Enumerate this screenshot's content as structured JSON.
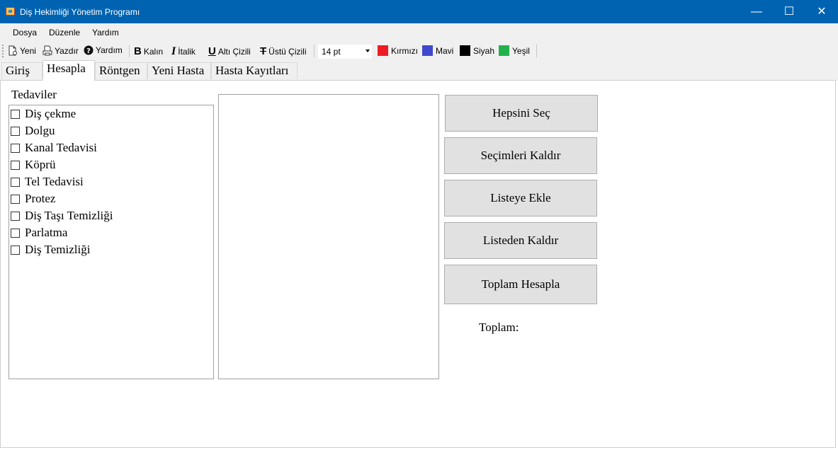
{
  "window": {
    "title": "Diş Hekimliği Yönetim Programı",
    "minimize": "—",
    "maximize": "☐",
    "close": "✕"
  },
  "menu": [
    "Dosya",
    "Düzenle",
    "Yardım"
  ],
  "toolbar": {
    "new_label": "Yeni",
    "print_label": "Yazdır",
    "help_label": "Yardım",
    "bold_label": "Kalın",
    "italic_label": "İtalik",
    "underline_label": "Altı Çizili",
    "strike_label": "Üstü Çizili",
    "font_size": "14 pt",
    "colors": [
      {
        "label": "Kırmızı",
        "color": "#ed1c24"
      },
      {
        "label": "Mavi",
        "color": "#3f48cc"
      },
      {
        "label": "Siyah",
        "color": "#000000"
      },
      {
        "label": "Yeşil",
        "color": "#22b14c"
      }
    ]
  },
  "tabs": [
    "Giriş",
    "Hesapla",
    "Röntgen",
    "Yeni Hasta",
    "Hasta Kayıtları"
  ],
  "active_tab": "Hesapla",
  "treatments": {
    "label": "Tedaviler",
    "items": [
      "Diş çekme",
      "Dolgu",
      "Kanal Tedavisi",
      "Köprü",
      "Tel Tedavisi",
      "Protez",
      "Diş Taşı Temizliği",
      "Parlatma",
      "Diş Temizliği"
    ]
  },
  "buttons": {
    "select_all": "Hepsini Seç",
    "clear_selection": "Seçimleri Kaldır",
    "add_to_list": "Listeye Ekle",
    "remove_from_list": "Listeden Kaldır",
    "calc_total": "Toplam Hesapla"
  },
  "total_label": "Toplam:"
}
